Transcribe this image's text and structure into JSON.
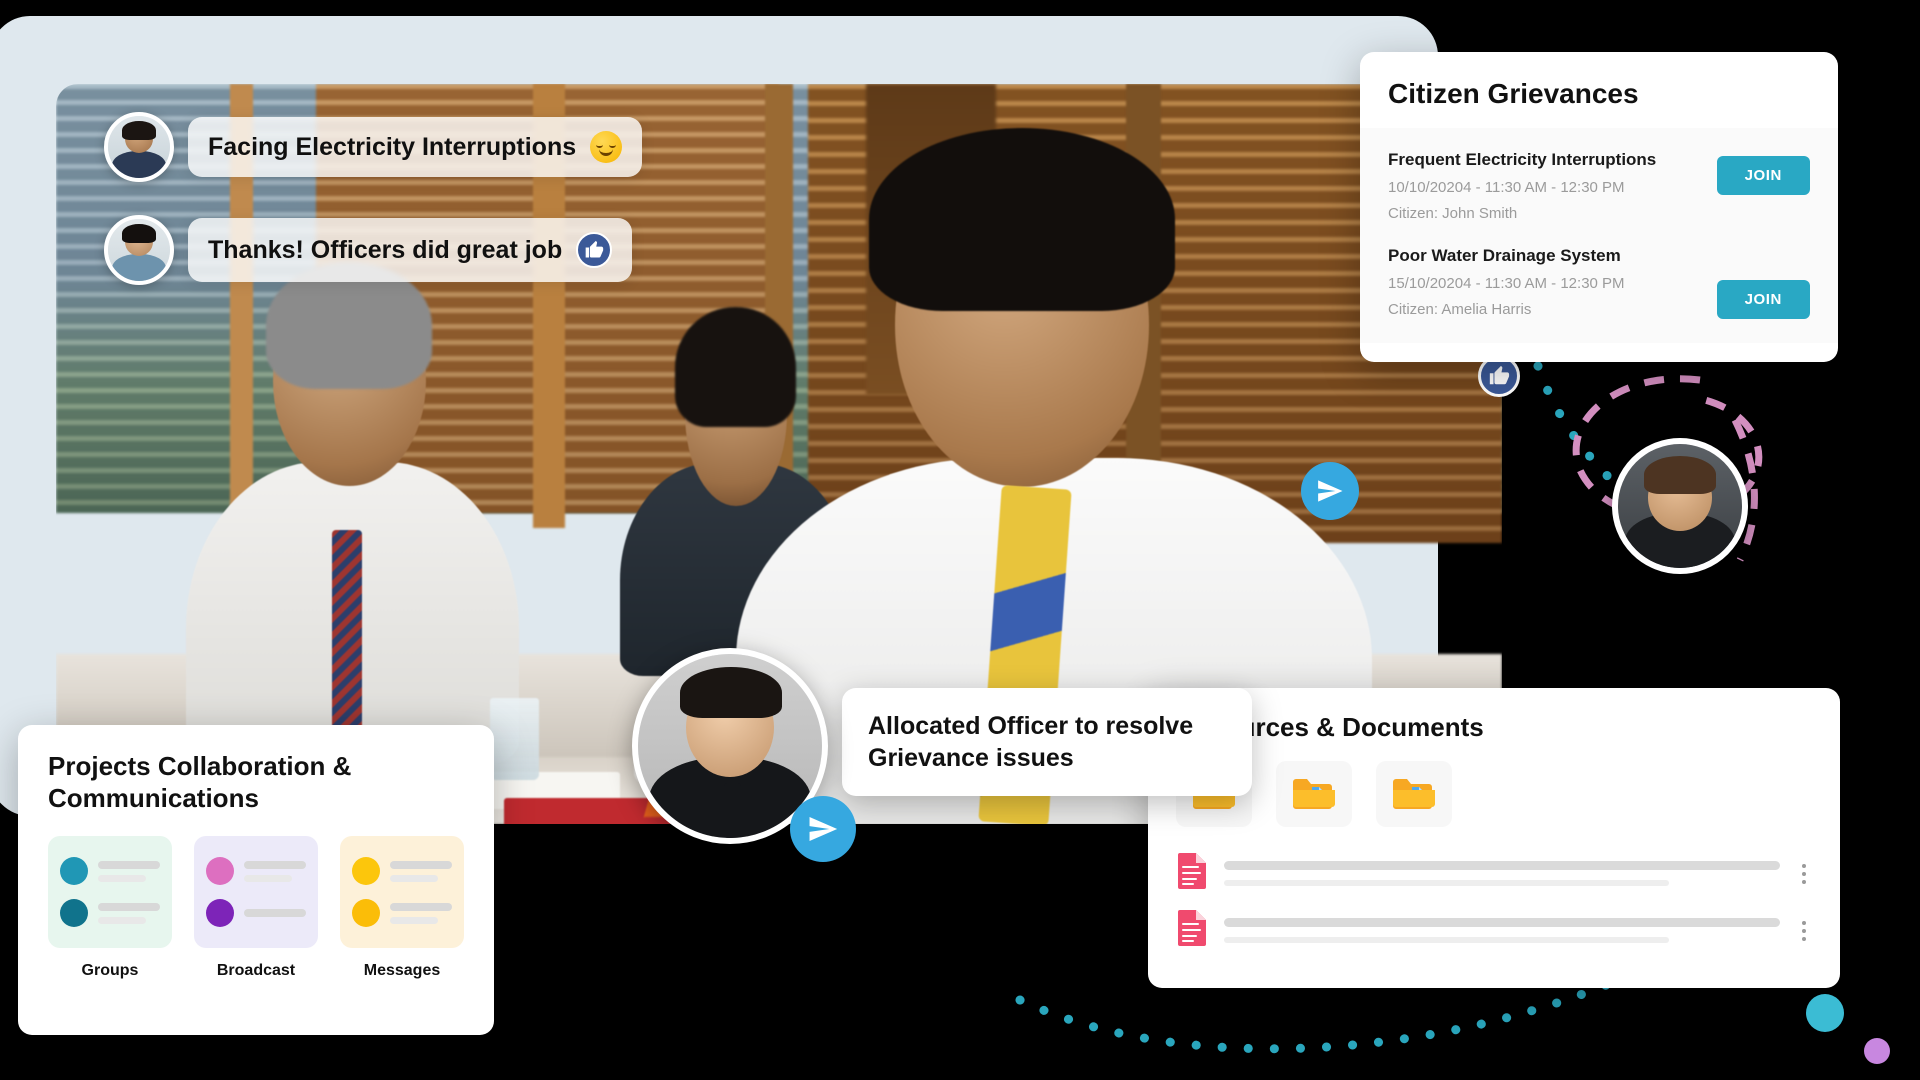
{
  "hero": {
    "alt": "office-meeting-photo",
    "chat_messages": [
      {
        "id": "msg-1",
        "text": "Facing Electricity Interruptions",
        "reaction": "smiling-face-emoji",
        "avatar": "bearded-man-in-suit"
      },
      {
        "id": "msg-2",
        "text": "Thanks! Officers did great job",
        "reaction": "thumbs-up-icon",
        "avatar": "woman-in-blue-shirt"
      }
    ]
  },
  "grievances": {
    "title": "Citizen Grievances",
    "items": [
      {
        "title": "Frequent Electricity Interruptions",
        "schedule": "10/10/20204 - 11:30 AM - 12:30 PM",
        "citizen": "Citizen: John Smith",
        "action_label": "JOIN"
      },
      {
        "title": "Poor Water Drainage System",
        "schedule": "15/10/20204 - 11:30 AM - 12:30 PM",
        "citizen": "Citizen: Amelia Harris",
        "action_label": "JOIN"
      }
    ]
  },
  "projects": {
    "title": "Projects  Collaboration & Communications",
    "tiles": [
      {
        "label": "Groups",
        "bg": "#e7f6ee",
        "dot_top": "#2097b5",
        "dot_bottom": "#10738c"
      },
      {
        "label": "Broadcast",
        "bg": "#eceaf9",
        "dot_top": "#dd6fc0",
        "dot_bottom": "#7d24b8"
      },
      {
        "label": "Messages",
        "bg": "#fdf1d9",
        "dot_top": "#fcc60c",
        "dot_bottom": "#fbbd08"
      }
    ]
  },
  "resources": {
    "title": "Resources & Documents",
    "folders": [
      {
        "name": "folder-icon-1"
      },
      {
        "name": "folder-icon-2"
      },
      {
        "name": "folder-icon-3"
      }
    ],
    "documents": [
      {
        "name": "document-row-1",
        "menu": "more-options-icon"
      },
      {
        "name": "document-row-2",
        "menu": "more-options-icon"
      }
    ]
  },
  "officer_callout": {
    "text": "Allocated Officer to resolve Grievance issues",
    "avatar": "officer-in-suit",
    "badge": "send-icon"
  },
  "floating": {
    "woman_avatar": "woman-in-white-top",
    "man_avatar": "smiling-man-in-suit",
    "like_badge": "thumbs-up-icon",
    "send_badge": "send-icon",
    "blob_teal": "#3bbcd4",
    "blob_purple": "#c887e0"
  },
  "colors": {
    "accent_join": "#29a8c4",
    "accent_send": "#36a8e0",
    "like_blue": "#3b5998",
    "dot_teal": "#2aa6bd",
    "dash_pink": "#d38fc0",
    "frame_plate": "#dfe8ee",
    "page_background": "#000000"
  }
}
